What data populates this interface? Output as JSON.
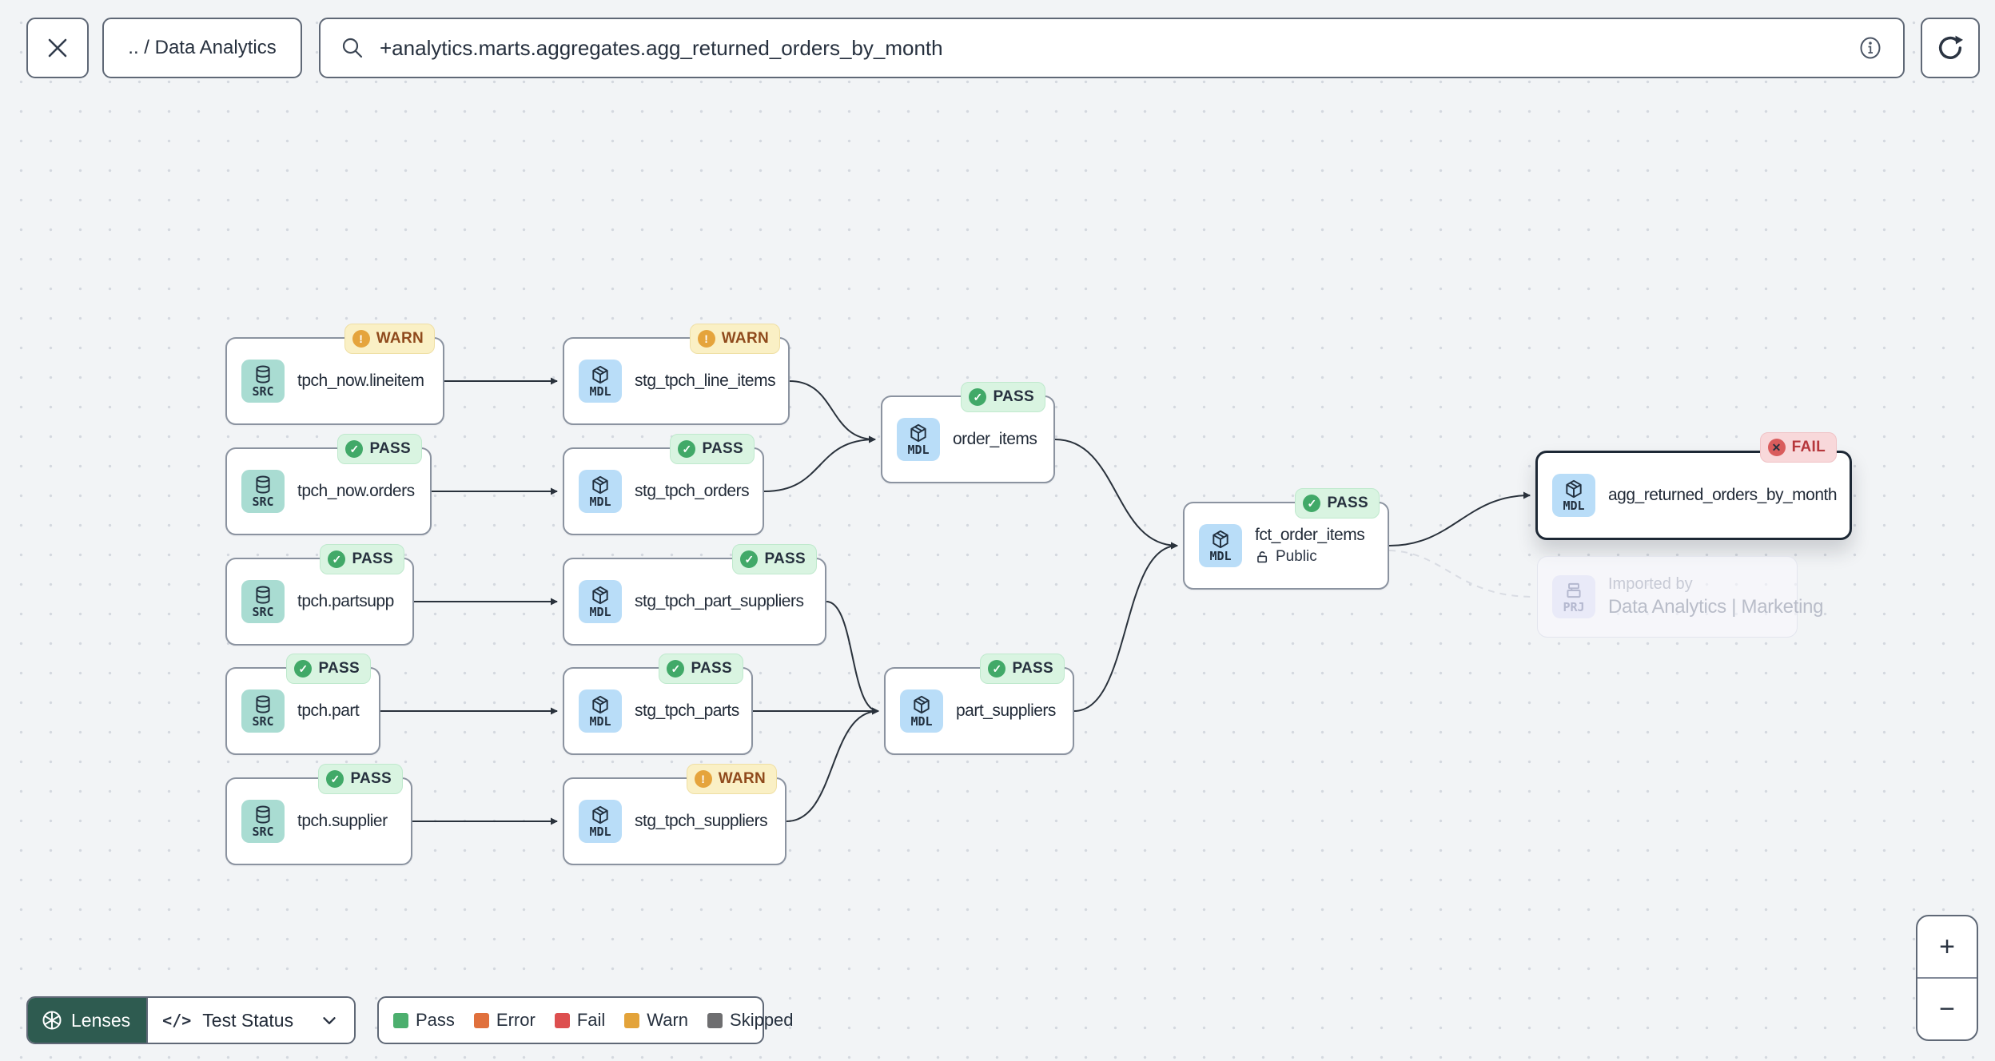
{
  "toolbar": {
    "breadcrumb": ".. / Data Analytics",
    "search_value": "+analytics.marts.aggregates.agg_returned_orders_by_month"
  },
  "graph": {
    "nodes": [
      {
        "id": "tpch_now_lineitem",
        "type": "SRC",
        "label": "tpch_now.lineitem",
        "status": "WARN"
      },
      {
        "id": "tpch_now_orders",
        "type": "SRC",
        "label": "tpch_now.orders",
        "status": "PASS"
      },
      {
        "id": "tpch_partsupp",
        "type": "SRC",
        "label": "tpch.partsupp",
        "status": "PASS"
      },
      {
        "id": "tpch_part",
        "type": "SRC",
        "label": "tpch.part",
        "status": "PASS"
      },
      {
        "id": "tpch_supplier",
        "type": "SRC",
        "label": "tpch.supplier",
        "status": "PASS"
      },
      {
        "id": "stg_tpch_line_items",
        "type": "MDL",
        "label": "stg_tpch_line_items",
        "status": "WARN"
      },
      {
        "id": "stg_tpch_orders",
        "type": "MDL",
        "label": "stg_tpch_orders",
        "status": "PASS"
      },
      {
        "id": "stg_tpch_part_suppliers",
        "type": "MDL",
        "label": "stg_tpch_part_suppliers",
        "status": "PASS"
      },
      {
        "id": "stg_tpch_parts",
        "type": "MDL",
        "label": "stg_tpch_parts",
        "status": "PASS"
      },
      {
        "id": "stg_tpch_suppliers",
        "type": "MDL",
        "label": "stg_tpch_suppliers",
        "status": "WARN"
      },
      {
        "id": "order_items",
        "type": "MDL",
        "label": "order_items",
        "status": "PASS"
      },
      {
        "id": "part_suppliers",
        "type": "MDL",
        "label": "part_suppliers",
        "status": "PASS"
      },
      {
        "id": "fct_order_items",
        "type": "MDL",
        "label": "fct_order_items",
        "status": "PASS",
        "visibility": "Public"
      },
      {
        "id": "agg_returned_orders_by_month",
        "type": "MDL",
        "label": "agg_returned_orders_by_month",
        "status": "FAIL",
        "selected": true
      }
    ],
    "imported_node": {
      "id": "imported_marketing",
      "type": "PRJ",
      "pretitle": "Imported by",
      "label": "Data Analytics | Marketing"
    },
    "edges": [
      [
        "tpch_now_lineitem",
        "stg_tpch_line_items"
      ],
      [
        "tpch_now_orders",
        "stg_tpch_orders"
      ],
      [
        "tpch_partsupp",
        "stg_tpch_part_suppliers"
      ],
      [
        "tpch_part",
        "stg_tpch_parts"
      ],
      [
        "tpch_supplier",
        "stg_tpch_suppliers"
      ],
      [
        "stg_tpch_line_items",
        "order_items"
      ],
      [
        "stg_tpch_orders",
        "order_items"
      ],
      [
        "stg_tpch_part_suppliers",
        "part_suppliers"
      ],
      [
        "stg_tpch_parts",
        "part_suppliers"
      ],
      [
        "stg_tpch_suppliers",
        "part_suppliers"
      ],
      [
        "order_items",
        "fct_order_items"
      ],
      [
        "part_suppliers",
        "fct_order_items"
      ],
      [
        "fct_order_items",
        "agg_returned_orders_by_month"
      ]
    ],
    "dashed_edges": [
      [
        "fct_order_items",
        "imported_marketing"
      ]
    ]
  },
  "controls": {
    "lenses_label": "Lenses",
    "lens_selector_label": "Test Status",
    "legend": [
      {
        "label": "Pass",
        "color": "#4caf6e"
      },
      {
        "label": "Error",
        "color": "#e0703c"
      },
      {
        "label": "Fail",
        "color": "#dd4f4f"
      },
      {
        "label": "Warn",
        "color": "#e3a33a"
      },
      {
        "label": "Skipped",
        "color": "#6e6e70"
      }
    ],
    "zoom_in_label": "+",
    "zoom_out_label": "−"
  },
  "status_colors": {
    "PASS": {
      "badge_bg": "#d9f4e1",
      "icon": "#41a968",
      "text": "#26303e"
    },
    "WARN": {
      "badge_bg": "#faf0c5",
      "icon": "#e5a43c",
      "text": "#8f4a1c"
    },
    "FAIL": {
      "badge_bg": "#f8d8da",
      "icon": "#d95c5c",
      "text": "#b6373c"
    }
  },
  "accent_colors": {
    "lenses_green": "#2e5b50",
    "src_chip": "#a9dcd2",
    "mdl_chip": "#b9ddf8",
    "prj_chip": "#e9eaf8",
    "edge": "#2a323c"
  }
}
